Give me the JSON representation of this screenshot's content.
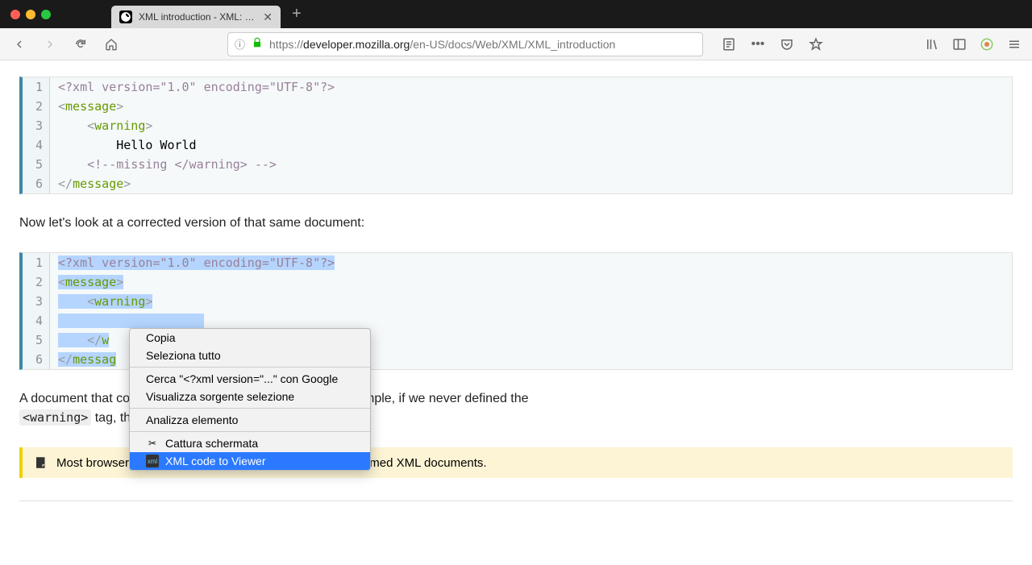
{
  "tab": {
    "title": "XML introduction - XML: Extens"
  },
  "url": {
    "prefix": "https://",
    "host": "developer.mozilla.org",
    "path": "/en-US/docs/Web/XML/XML_introduction"
  },
  "code1": {
    "lines": [
      {
        "n": "1",
        "html": "<span class='prolog'>&lt;?xml version=\"1.0\" encoding=\"UTF-8\"?&gt;</span>"
      },
      {
        "n": "2",
        "html": "<span class='tag-punct'>&lt;</span><span class='tag-name'>message</span><span class='tag-punct'>&gt;</span>"
      },
      {
        "n": "3",
        "html": "    <span class='tag-punct'>&lt;</span><span class='tag-name'>warning</span><span class='tag-punct'>&gt;</span>"
      },
      {
        "n": "4",
        "html": "        Hello World"
      },
      {
        "n": "5",
        "html": "    <span class='comment'>&lt;!--missing &lt;/warning&gt; --&gt;</span>"
      },
      {
        "n": "6",
        "html": "<span class='tag-punct'>&lt;/</span><span class='tag-name'>message</span><span class='tag-punct'>&gt;</span>"
      }
    ]
  },
  "para1": "Now let's look at a corrected version of that same document:",
  "code2": {
    "lines": [
      {
        "n": "1",
        "html": "<span class='selected'><span class='prolog'>&lt;?xml version=\"1.0\" encoding=\"UTF-8\"?&gt;</span></span>"
      },
      {
        "n": "2",
        "html": "<span class='selected'><span class='tag-punct'>&lt;</span><span class='tag-name'>message</span><span class='tag-punct'>&gt;</span></span>"
      },
      {
        "n": "3",
        "html": "<span class='selected'>    <span class='tag-punct'>&lt;</span><span class='tag-name'>warning</span><span class='tag-punct'>&gt;</span></span>"
      },
      {
        "n": "4",
        "html": "<span class='selected'>                    </span>"
      },
      {
        "n": "5",
        "html": "<span class='selected'>    <span class='tag-punct'>&lt;/</span><span class='tag-name'>w</span></span>"
      },
      {
        "n": "6",
        "html": "<span class='selected'><span class='tag-punct'>&lt;/</span><span class='tag-name'>messag</span></span>"
      }
    ]
  },
  "para2_a": "A document that co",
  "para2_b": "mple, if we never defined the ",
  "para2_tag": "<warning>",
  "para2_c": " tag, th",
  "note": "Most browsers offer a debugger that can identify poorly-formed XML documents.",
  "menu": {
    "copy": "Copia",
    "select_all": "Seleziona tutto",
    "search": "Cerca \"<?xml version=\"...\" con Google",
    "view_source": "Visualizza sorgente selezione",
    "inspect": "Analizza elemento",
    "screenshot": "Cattura schermata",
    "xml_viewer": "XML code to Viewer"
  }
}
